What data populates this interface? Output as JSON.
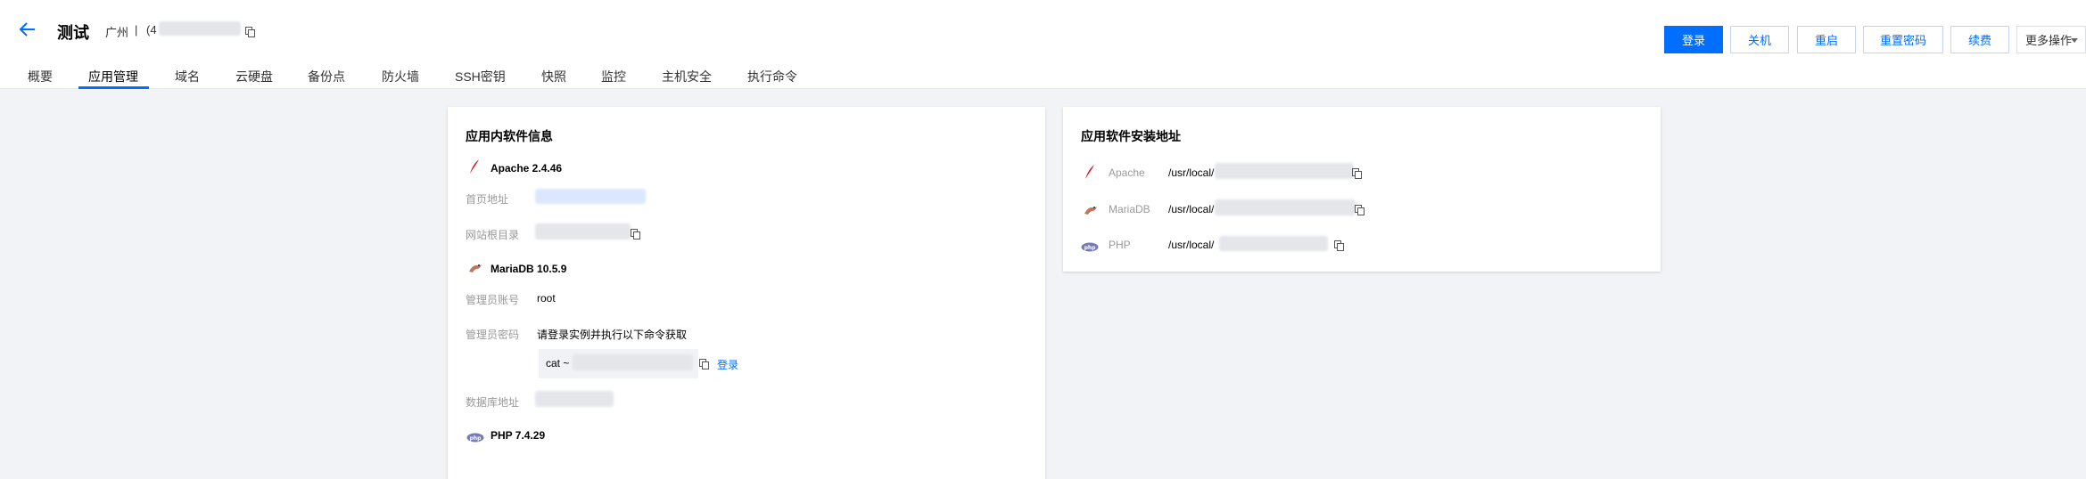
{
  "header": {
    "title": "测试",
    "region": "广州",
    "separator": "|",
    "ip_prefix": "(4"
  },
  "actions": {
    "login": "登录",
    "shutdown": "关机",
    "restart": "重启",
    "reset_password": "重置密码",
    "renew": "续费",
    "more": "更多操作"
  },
  "tabs": [
    "概要",
    "应用管理",
    "域名",
    "云硬盘",
    "备份点",
    "防火墙",
    "SSH密钥",
    "快照",
    "监控",
    "主机安全",
    "执行命令"
  ],
  "active_tab": "应用管理",
  "software_info": {
    "title": "应用内软件信息",
    "apache": {
      "name": "Apache 2.4.46",
      "homepage_label": "首页地址",
      "webroot_label": "网站根目录"
    },
    "mariadb": {
      "name": "MariaDB 10.5.9",
      "admin_account_label": "管理员账号",
      "admin_account_value": "root",
      "admin_password_label": "管理员密码",
      "password_hint": "请登录实例并执行以下命令获取",
      "command_prefix": "cat ~",
      "login_link": "登录",
      "db_address_label": "数据库地址"
    },
    "php": {
      "name": "PHP 7.4.29"
    }
  },
  "install_paths": {
    "title": "应用软件安装地址",
    "items": [
      {
        "name": "Apache",
        "path": "/usr/local/",
        "icon": "apache-feather-icon"
      },
      {
        "name": "MariaDB",
        "path": "/usr/local/",
        "icon": "mariadb-seal-icon"
      },
      {
        "name": "PHP",
        "path": "/usr/local/",
        "icon": "php-logo-icon"
      }
    ]
  },
  "colors": {
    "primary": "#006eff",
    "page_bg": "#f2f3f7",
    "label_gray": "#999999"
  }
}
